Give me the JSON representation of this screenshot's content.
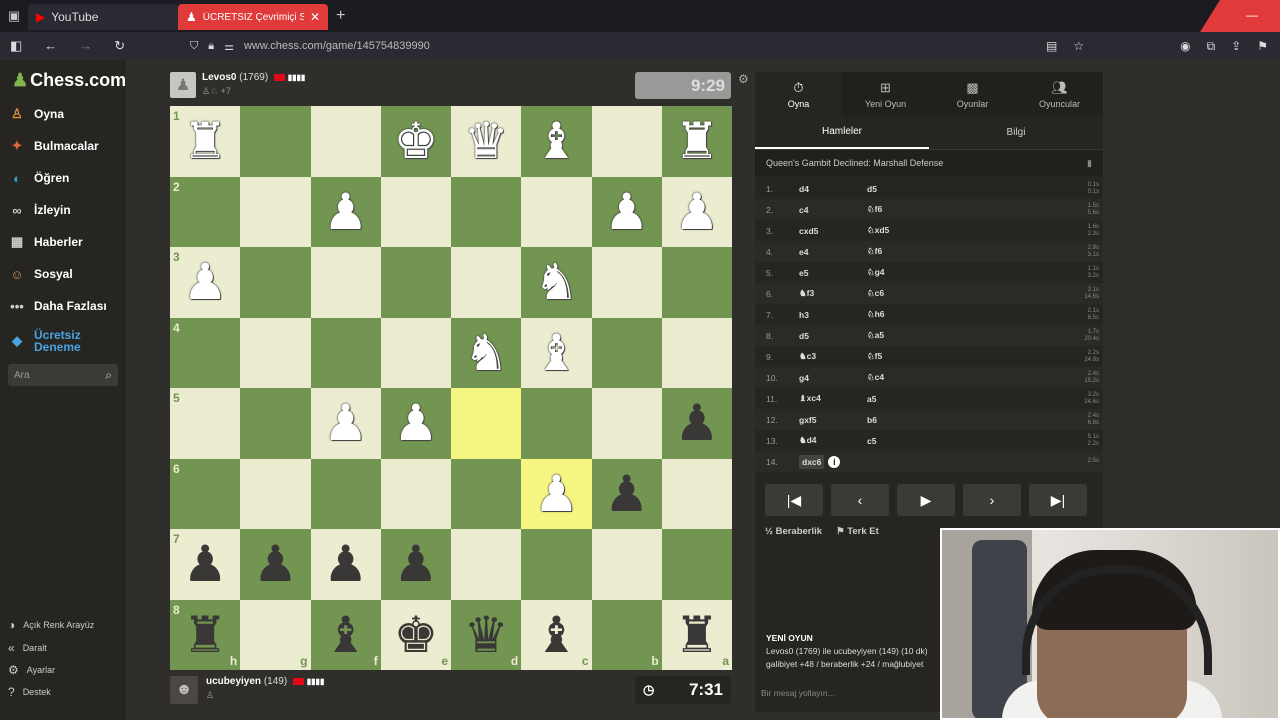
{
  "browser": {
    "tabs": [
      {
        "label": "YouTube"
      },
      {
        "label": "ÜCRETSİZ Çevrimiçi Satranç Oy"
      }
    ],
    "url": "www.chess.com/game/145754839990"
  },
  "sidebar": {
    "logo": "Chess.com",
    "items": [
      {
        "label": "Oyna"
      },
      {
        "label": "Bulmacalar"
      },
      {
        "label": "Öğren"
      },
      {
        "label": "İzleyin"
      },
      {
        "label": "Haberler"
      },
      {
        "label": "Sosyal"
      },
      {
        "label": "Daha Fazlası"
      },
      {
        "label": "Ücretsiz Deneme"
      }
    ],
    "search_placeholder": "Ara",
    "bottom": [
      {
        "label": "Açık Renk Arayüz"
      },
      {
        "label": "Daralt"
      },
      {
        "label": "Ayarlar"
      },
      {
        "label": "Destek"
      }
    ]
  },
  "top_player": {
    "name": "Levos0",
    "rating": "(1769)",
    "sub": "+7",
    "clock": "9:29"
  },
  "bottom_player": {
    "name": "ucubeyiyen",
    "rating": "(149)",
    "clock": "7:31"
  },
  "board": {
    "orientation": "black",
    "ranks": [
      "1",
      "2",
      "3",
      "4",
      "5",
      "6",
      "7",
      "8"
    ],
    "files": [
      "h",
      "g",
      "f",
      "e",
      "d",
      "c",
      "b",
      "a"
    ],
    "highlight": [
      "d5",
      "c6"
    ],
    "rows": [
      [
        "wR",
        "",
        "",
        "wK",
        "wQ",
        "wB",
        "",
        "wR"
      ],
      [
        "",
        "",
        "wP",
        "",
        "",
        "",
        "wP",
        "wP"
      ],
      [
        "wP",
        "",
        "",
        "",
        "",
        "wN",
        "",
        ""
      ],
      [
        "",
        "",
        "",
        "",
        "wN",
        "wB",
        "",
        ""
      ],
      [
        "",
        "",
        "wP",
        "wP",
        "",
        "",
        "",
        "bP"
      ],
      [
        "",
        "",
        "",
        "",
        "",
        "wP",
        "bP",
        ""
      ],
      [
        "bP",
        "bP",
        "bP",
        "bP",
        "",
        "",
        "",
        ""
      ],
      [
        "bR",
        "",
        "bB",
        "bK",
        "bQ",
        "bB",
        "",
        "bR"
      ]
    ]
  },
  "panel": {
    "tabs": [
      {
        "label": "Oyna",
        "icon": "stopwatch"
      },
      {
        "label": "Yeni Oyun",
        "icon": "plus"
      },
      {
        "label": "Oyunlar",
        "icon": "grid"
      },
      {
        "label": "Oyuncular",
        "icon": "people"
      }
    ],
    "subtabs": [
      "Hamleler",
      "Bilgi"
    ],
    "opening": "Queen's Gambit Declined: Marshall Defense",
    "moves": [
      {
        "n": "1.",
        "w": "d4",
        "b": "d5",
        "tw": "0.1s",
        "tb": "0.1s"
      },
      {
        "n": "2.",
        "w": "c4",
        "b": "♘f6",
        "tw": "1.5s",
        "tb": "5.6s"
      },
      {
        "n": "3.",
        "w": "cxd5",
        "b": "♘xd5",
        "tw": "1.6s",
        "tb": "2.3s"
      },
      {
        "n": "4.",
        "w": "e4",
        "b": "♘f6",
        "tw": "2.9s",
        "tb": "3.1s"
      },
      {
        "n": "5.",
        "w": "e5",
        "b": "♘g4",
        "tw": "1.1s",
        "tb": "3.2s"
      },
      {
        "n": "6.",
        "w": "♞f3",
        "b": "♘c6",
        "tw": "2.1s",
        "tb": "14.6s"
      },
      {
        "n": "7.",
        "w": "h3",
        "b": "♘h6",
        "tw": "2.1s",
        "tb": "8.5s"
      },
      {
        "n": "8.",
        "w": "d5",
        "b": "♘a5",
        "tw": "1.7s",
        "tb": "20.4s"
      },
      {
        "n": "9.",
        "w": "♞c3",
        "b": "♘f5",
        "tw": "2.2s",
        "tb": "24.9s"
      },
      {
        "n": "10.",
        "w": "g4",
        "b": "♘c4",
        "tw": "2.4s",
        "tb": "15.2s"
      },
      {
        "n": "11.",
        "w": "♝xc4",
        "b": "a5",
        "tw": "3.2s",
        "tb": "24.6s"
      },
      {
        "n": "12.",
        "w": "gxf5",
        "b": "b6",
        "tw": "2.4s",
        "tb": "6.8s"
      },
      {
        "n": "13.",
        "w": "♞d4",
        "b": "c5",
        "tw": "5.1s",
        "tb": "2.2s"
      },
      {
        "n": "14.",
        "w": "dxc6",
        "b": "",
        "tw": "2.5s",
        "tb": ""
      }
    ],
    "actions": {
      "draw": "Beraberlik",
      "resign": "Terk Et"
    },
    "new_game_title": "YENİ OYUN",
    "new_game_text1": "Levos0 (1769) ile ucubeyiyen (149) (10 dk)",
    "new_game_text2": "galibiyet +48 / beraberlik +24 / mağlubiyet",
    "chat_placeholder": "Bir mesaj yollayın..."
  }
}
